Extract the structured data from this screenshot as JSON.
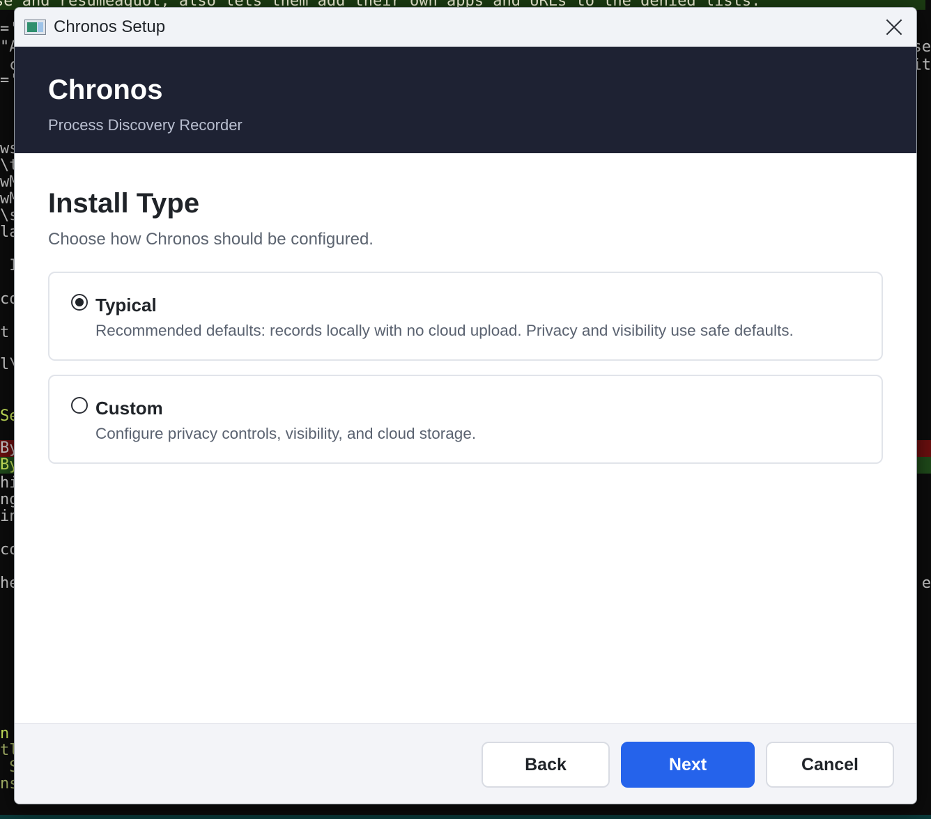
{
  "terminal": {
    "top_line": "se and resumeaquot, also lets them add their own apps and URLs to the denied lists.",
    "lines": [
      {
        "text": "='",
        "cls": ""
      },
      {
        "text": "\"A",
        "cls": ""
      },
      {
        "text": " c",
        "cls": ""
      },
      {
        "text": "='",
        "cls": ""
      },
      {
        "text": "ws",
        "cls": ""
      },
      {
        "text": "\\t",
        "cls": ""
      },
      {
        "text": "wM",
        "cls": ""
      },
      {
        "text": "wM",
        "cls": ""
      },
      {
        "text": "\\s",
        "cls": ""
      },
      {
        "text": "la",
        "cls": ""
      },
      {
        "text": " I",
        "cls": ""
      },
      {
        "text": "co",
        "cls": ""
      },
      {
        "text": "t",
        "cls": ""
      },
      {
        "text": "l\\",
        "cls": ""
      },
      {
        "text": "Se",
        "cls": "green"
      },
      {
        "text": "By",
        "cls": "red-bg"
      },
      {
        "text": "By",
        "cls": "green-bg"
      },
      {
        "text": "hi",
        "cls": ""
      },
      {
        "text": "ng",
        "cls": ""
      },
      {
        "text": "in",
        "cls": ""
      },
      {
        "text": "co",
        "cls": ""
      },
      {
        "text": "he",
        "cls": ""
      },
      {
        "text": "n",
        "cls": "green"
      },
      {
        "text": "tl",
        "cls": "olive"
      },
      {
        "text": " S",
        "cls": "olive"
      },
      {
        "text": "ns",
        "cls": "olive"
      }
    ],
    "right_lines": [
      "se",
      "it",
      "e"
    ]
  },
  "window": {
    "title": "Chronos Setup",
    "header": {
      "brand": "Chronos",
      "subtitle": "Process Discovery Recorder"
    },
    "page": {
      "title": "Install Type",
      "subtitle": "Choose how Chronos should be configured."
    },
    "options": [
      {
        "label": "Typical",
        "description": "Recommended defaults: records locally with no cloud upload. Privacy and visibility use safe defaults.",
        "selected": true
      },
      {
        "label": "Custom",
        "description": "Configure privacy controls, visibility, and cloud storage.",
        "selected": false
      }
    ],
    "buttons": {
      "back": "Back",
      "next": "Next",
      "cancel": "Cancel"
    },
    "colors": {
      "header_bg": "#1e2233",
      "primary": "#2563eb"
    }
  }
}
